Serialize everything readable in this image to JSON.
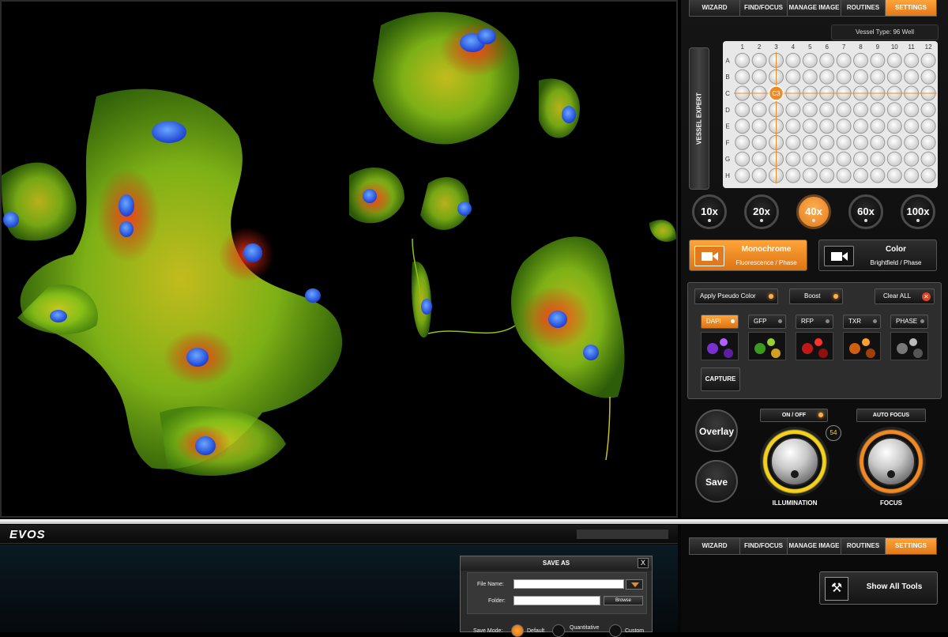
{
  "tabs": [
    "WIZARD",
    "FIND/FOCUS",
    "MANAGE IMAGE",
    "ROUTINES",
    "SETTINGS"
  ],
  "active_tab": "SETTINGS",
  "vessel": {
    "type_label": "Vessel Type: 96 Well",
    "expert_label": "VESSEL EXPERT",
    "columns": [
      "1",
      "2",
      "3",
      "4",
      "5",
      "6",
      "7",
      "8",
      "9",
      "10",
      "11",
      "12"
    ],
    "rows": [
      "A",
      "B",
      "C",
      "D",
      "E",
      "F",
      "G",
      "H"
    ],
    "selected_well": "C3"
  },
  "objectives": [
    {
      "label": "10x"
    },
    {
      "label": "20x"
    },
    {
      "label": "40x",
      "active": true
    },
    {
      "label": "60x"
    },
    {
      "label": "100x"
    }
  ],
  "camera": {
    "mono_title": "Monochrome",
    "mono_sub": "Fluorescence / Phase",
    "color_title": "Color",
    "color_sub": "Brightfield / Phase"
  },
  "fluorescence": {
    "pseudo_label": "Apply Pseudo Color",
    "boost_label": "Boost",
    "clear_label": "Clear ALL",
    "cubes": [
      "DAPI",
      "GFP",
      "RFP",
      "TXR",
      "PHASE"
    ],
    "active_cube": "DAPI",
    "capture_label": "CAPTURE"
  },
  "controls": {
    "overlay_label": "Overlay",
    "save_label": "Save",
    "onoff_label": "ON / OFF",
    "autofocus_label": "AUTO FOCUS",
    "illum_value": "54",
    "illum_label": "ILLUMINATION",
    "focus_label": "FOCUS"
  },
  "bottom": {
    "logo": "EVOS",
    "show_all_label": "Show All Tools"
  },
  "save_as": {
    "title": "SAVE AS",
    "close": "X",
    "file_name_label": "File Name:",
    "folder_label": "Folder:",
    "browse_label": "Browse",
    "save_mode_label": "Save Mode:",
    "mode_default": "Default",
    "mode_quantitative": "Quantitative",
    "mode_custom": "Custom"
  },
  "colors": {
    "accent": "#f08a24",
    "illumination_ring": "#f2d21e",
    "focus_ring": "#f08a24"
  }
}
